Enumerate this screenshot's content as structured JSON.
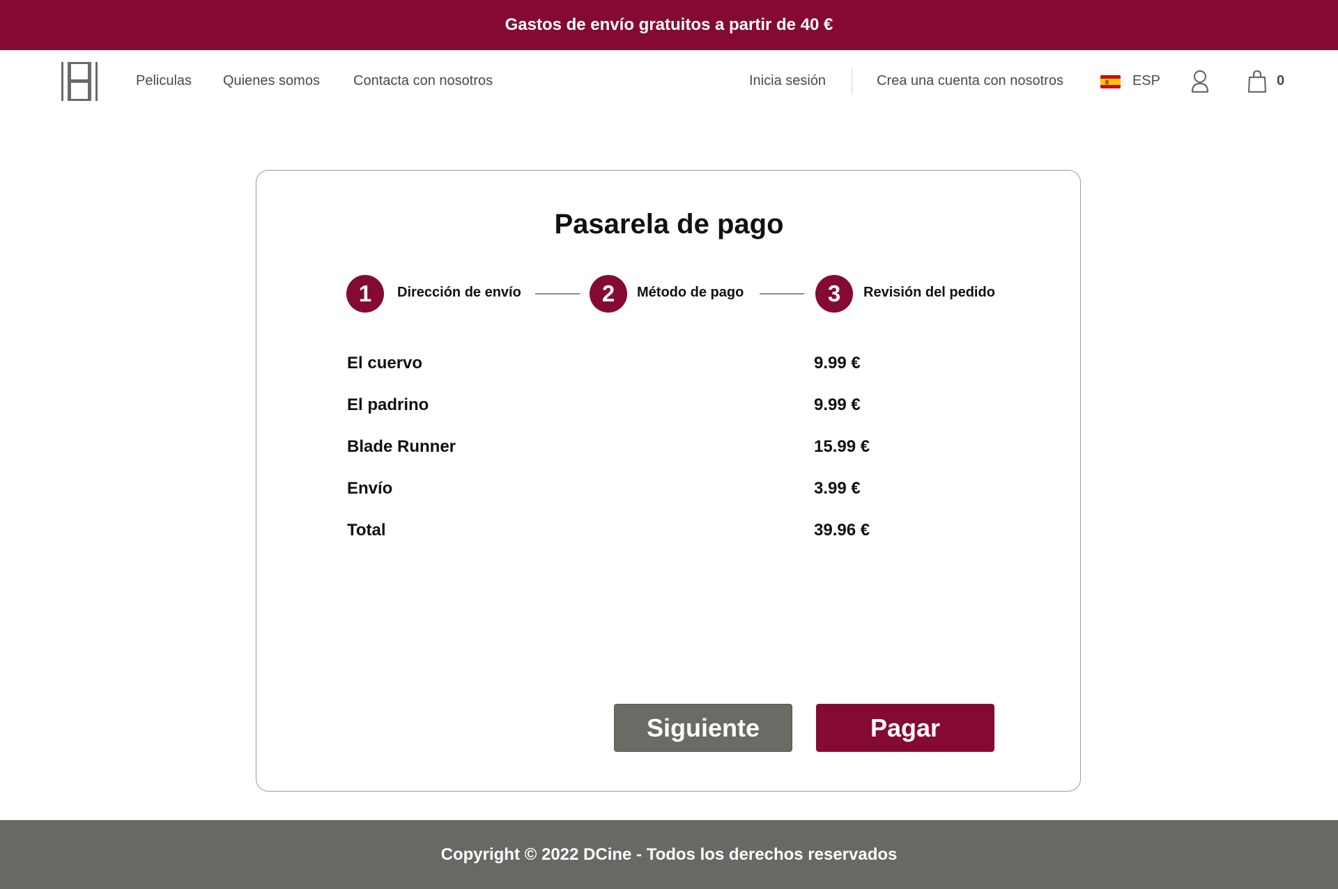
{
  "promo_bar": {
    "text": "Gastos de envío gratuitos a partir de 40 €"
  },
  "header": {
    "logo_icon": "film-strip-icon",
    "nav_links": [
      "Peliculas",
      "Quienes somos",
      "Contacta con nosotros"
    ],
    "login_label": "Inicia sesión",
    "signup_label": "Crea una cuenta con nosotros",
    "language": {
      "flag_icon": "spain-flag-icon",
      "code": "ESP"
    },
    "user_icon": "user-icon",
    "cart": {
      "icon": "shopping-bag-icon",
      "count": "0"
    }
  },
  "checkout": {
    "title": "Pasarela de pago",
    "steps": [
      {
        "number": "1",
        "label": "Dirección de envío"
      },
      {
        "number": "2",
        "label": "Método de pago"
      },
      {
        "number": "3",
        "label": "Revisión del pedido"
      }
    ],
    "summary": [
      {
        "label": "El cuervo",
        "value": "9.99 €"
      },
      {
        "label": "El padrino",
        "value": "9.99 €"
      },
      {
        "label": "Blade Runner",
        "value": "15.99 €"
      },
      {
        "label": "Envío",
        "value": "3.99 €"
      },
      {
        "label": "Total",
        "value": "39.96 €"
      }
    ],
    "next_button": "Siguiente",
    "pay_button": "Pagar"
  },
  "footer": {
    "text": "Copyright © 2022 DCine - Todos los derechos reservados"
  },
  "colors": {
    "brand": "#840a34",
    "footer_bg": "#686964",
    "secondary_button": "#6a6b65"
  }
}
